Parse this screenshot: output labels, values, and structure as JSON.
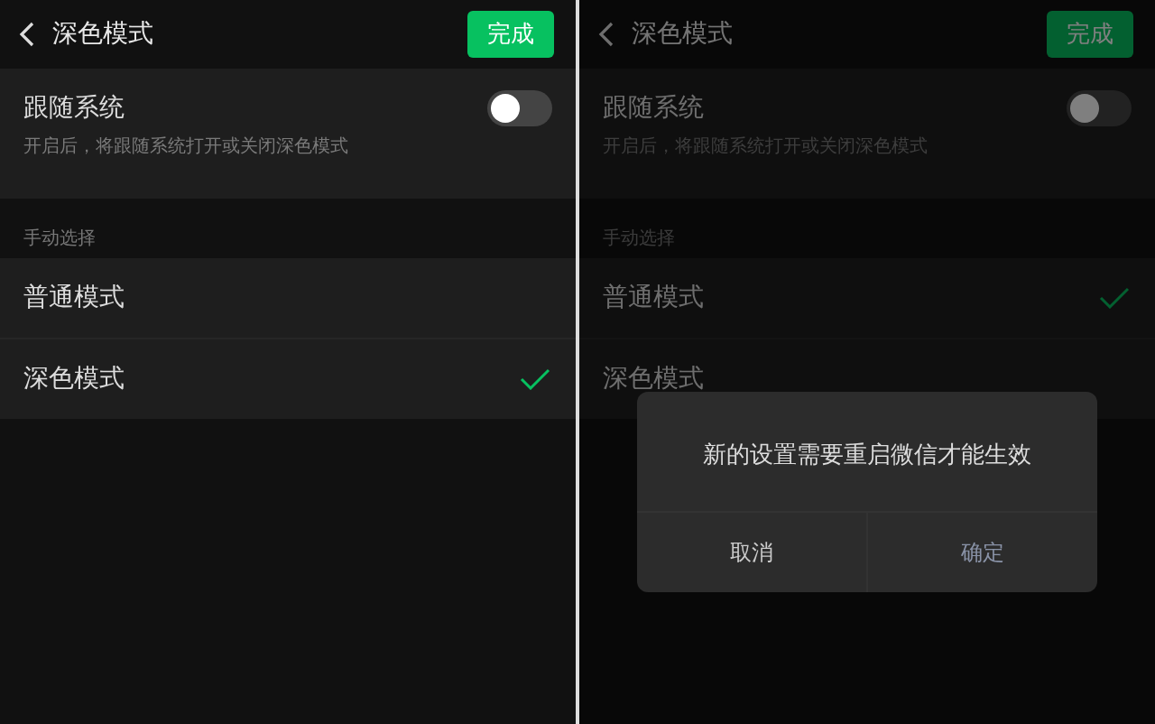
{
  "screens": [
    {
      "header": {
        "title": "深色模式",
        "done_button": "完成"
      },
      "follow_system": {
        "label": "跟随系统",
        "description": "开启后，将跟随系统打开或关闭深色模式",
        "on": false
      },
      "section_label": "手动选择",
      "modes": [
        {
          "label": "普通模式",
          "selected": false
        },
        {
          "label": "深色模式",
          "selected": true
        }
      ]
    },
    {
      "header": {
        "title": "深色模式",
        "done_button": "完成"
      },
      "follow_system": {
        "label": "跟随系统",
        "description": "开启后，将跟随系统打开或关闭深色模式",
        "on": false
      },
      "section_label": "手动选择",
      "modes": [
        {
          "label": "普通模式",
          "selected": true
        },
        {
          "label": "深色模式",
          "selected": false
        }
      ],
      "dialog": {
        "message": "新的设置需要重启微信才能生效",
        "buttons": [
          "取消",
          "确定"
        ]
      }
    }
  ]
}
